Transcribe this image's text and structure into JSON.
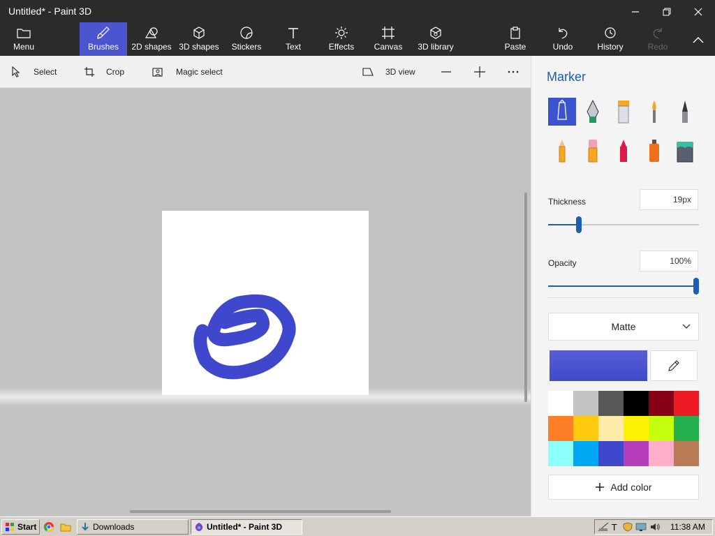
{
  "window": {
    "title": "Untitled* - Paint 3D"
  },
  "toolbar": {
    "menu": "Menu",
    "brushes": "Brushes",
    "shapes2d": "2D shapes",
    "shapes3d": "3D shapes",
    "stickers": "Stickers",
    "text": "Text",
    "effects": "Effects",
    "canvas": "Canvas",
    "library3d": "3D library",
    "paste": "Paste",
    "undo": "Undo",
    "history": "History",
    "redo": "Redo"
  },
  "subtoolbar": {
    "select": "Select",
    "crop": "Crop",
    "magic_select": "Magic select",
    "view3d": "3D view"
  },
  "panel": {
    "title": "Marker",
    "thickness_label": "Thickness",
    "thickness_value": "19px",
    "thickness_fraction": 0.19,
    "opacity_label": "Opacity",
    "opacity_value": "100%",
    "opacity_fraction": 1.0,
    "finish": "Matte",
    "current_color": "#3f48cc",
    "add_color": "Add color",
    "brushes": [
      "marker",
      "calligraphy-pen",
      "oil-brush",
      "watercolor",
      "pixel-pen",
      "pencil",
      "eraser",
      "crayon",
      "spray-can",
      "fill"
    ],
    "palette": [
      "#ffffff",
      "#c3c3c3",
      "#585858",
      "#000000",
      "#880015",
      "#ed1c24",
      "#ff7f27",
      "#ffc90e",
      "#fdeca6",
      "#fff200",
      "#c4ff0e",
      "#22b14c",
      "#8cfffb",
      "#00a8f3",
      "#3f48cc",
      "#b83dba",
      "#ffaec8",
      "#b97a56"
    ]
  },
  "taskbar": {
    "start": "Start",
    "downloads": "Downloads",
    "paint_window": "Untitled* - Paint 3D",
    "clock": "11:38 AM"
  }
}
